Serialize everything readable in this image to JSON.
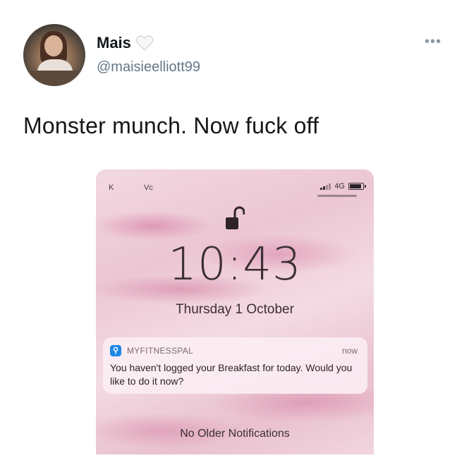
{
  "tweet": {
    "author_name": "Mais",
    "handle": "@maisieelliott99",
    "text": "Monster munch. Now fuck off"
  },
  "icons": {
    "heart": "white-heart-icon",
    "more": "more-options-icon",
    "lock": "unlocked-padlock-icon",
    "app": "myfitnesspal-app-icon"
  },
  "phone": {
    "status_left": "K",
    "status_carrier": "Vc",
    "network": "4G",
    "time": "10:43",
    "date": "Thursday 1 October",
    "notification": {
      "app_name": "MYFITNESSPAL",
      "time": "now",
      "body": "You haven't logged your Breakfast for today. Would you like to do it now?"
    },
    "no_older": "No Older Notifications"
  },
  "colors": {
    "app_icon": "#1e88e5",
    "handle": "#657786",
    "wallpaper": "#ecc6d4"
  }
}
